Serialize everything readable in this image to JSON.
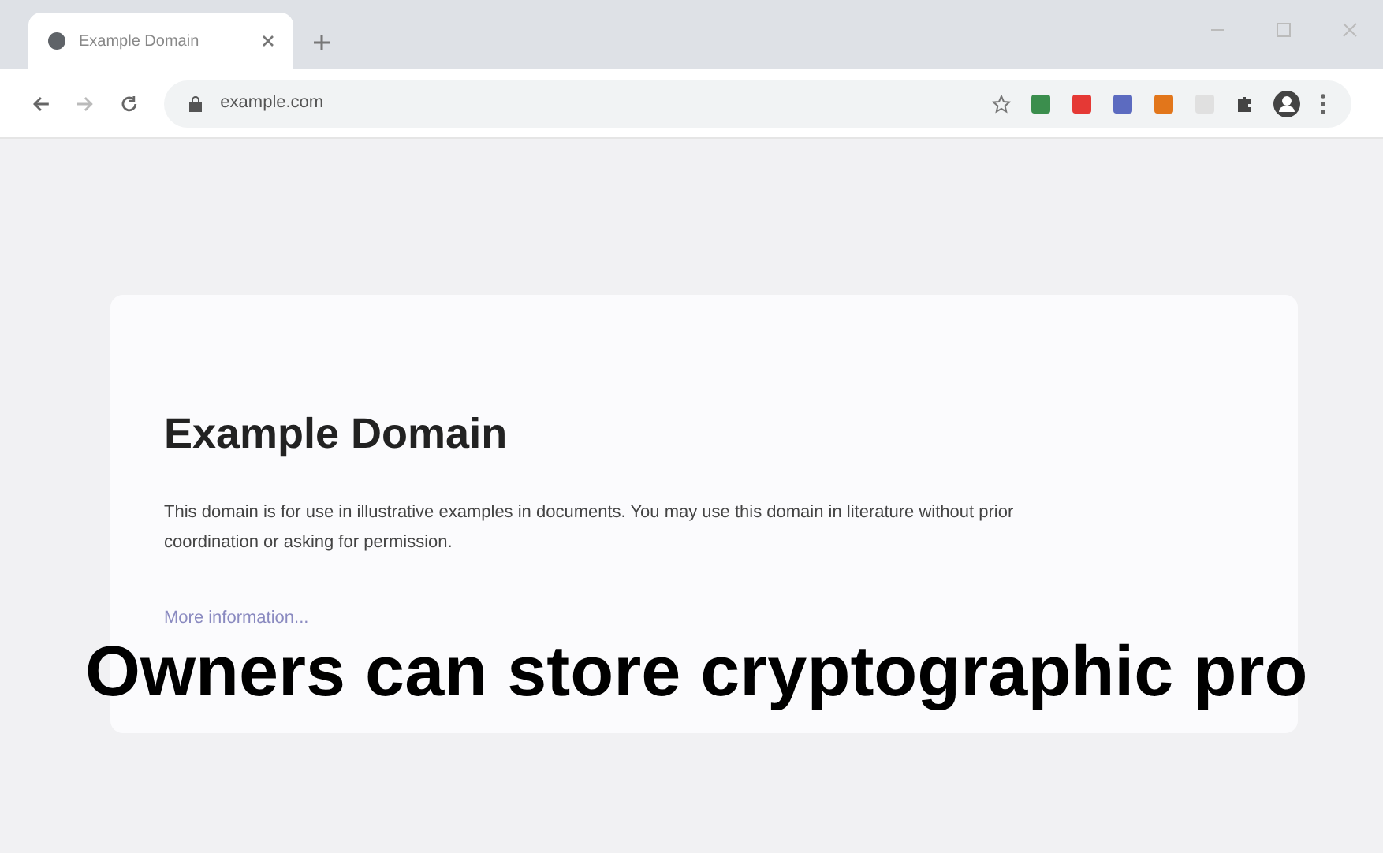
{
  "browser": {
    "tab": {
      "title": "Example Domain",
      "selected": true
    },
    "address": "example.com"
  },
  "page": {
    "heading": "Example Domain",
    "paragraph": "This domain is for use in illustrative examples in documents. You may use this domain in literature without prior coordination or asking for permission.",
    "link": "More information..."
  },
  "overlay": {
    "text": "Owners can store cryptographic pro"
  }
}
